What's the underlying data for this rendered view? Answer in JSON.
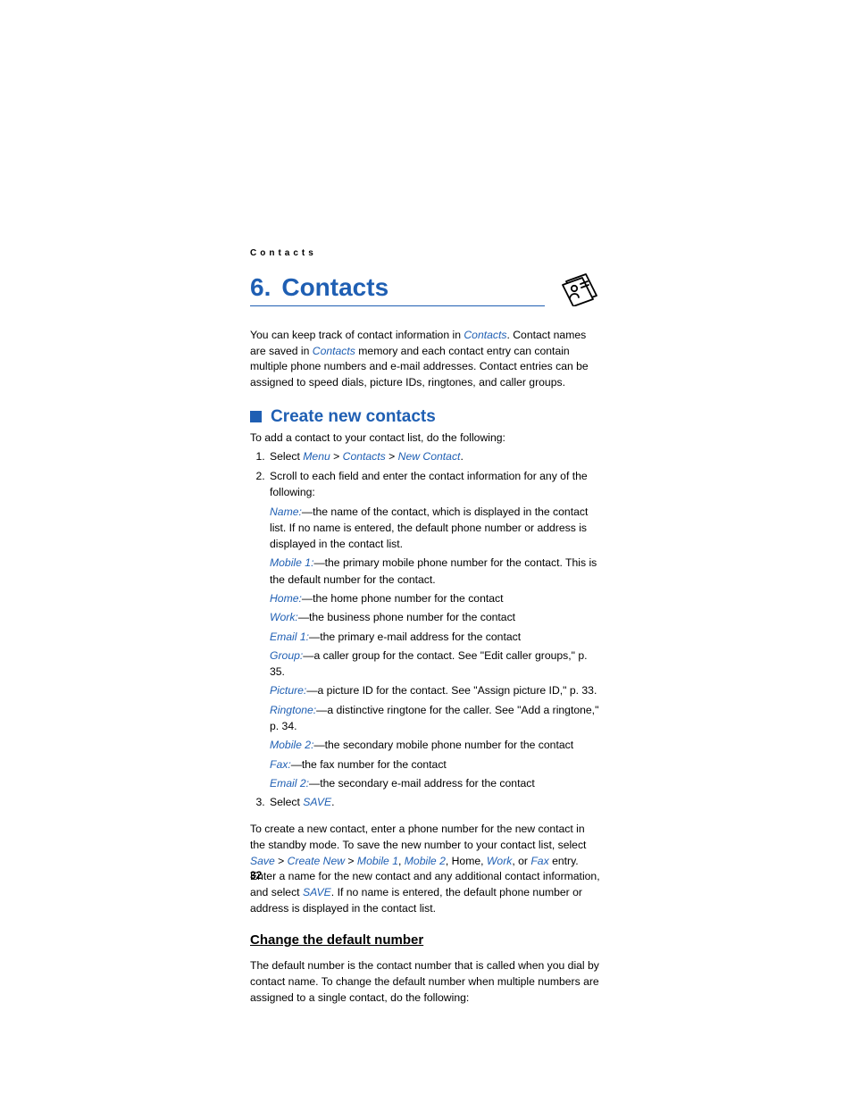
{
  "header": "Contacts",
  "chapter": {
    "num": "6.",
    "title": "Contacts"
  },
  "intro": {
    "t1": "You can keep track of contact information in ",
    "l1": "Contacts",
    "t2": ". Contact names are saved in ",
    "l2": "Contacts",
    "t3": " memory and each contact entry can contain multiple phone numbers and e-mail addresses. Contact entries can be assigned to speed dials, picture IDs, ringtones, and caller groups."
  },
  "sectionCreate": "Create new contacts",
  "createLead": "To add a contact to your contact list, do the following:",
  "step1": {
    "pre": "Select ",
    "menu": "Menu",
    "gt1": " > ",
    "contacts": "Contacts",
    "gt2": " > ",
    "newc": "New Contact",
    "post": "."
  },
  "step2": "Scroll to each field and enter the contact information for any of the following:",
  "fields": {
    "name": {
      "lbl": "Name:",
      "txt": "—the name of the contact, which is displayed in the contact list. If no name is entered, the default phone number or address is displayed in the contact list."
    },
    "mobile1": {
      "lbl": "Mobile 1:",
      "txt": "—the primary mobile phone number for the contact. This is the default number for the contact."
    },
    "home": {
      "lbl": "Home:",
      "txt": "—the home phone number for the contact"
    },
    "work": {
      "lbl": "Work:",
      "txt": "—the business phone number for the contact"
    },
    "email1": {
      "lbl": "Email 1:",
      "txt": "—the primary e-mail address for the contact"
    },
    "group": {
      "lbl": "Group:",
      "txt": "—a caller group for the contact. See \"Edit caller groups,\" p. 35."
    },
    "picture": {
      "lbl": "Picture:",
      "txt": "—a picture ID for the contact. See \"Assign picture ID,\" p. 33."
    },
    "ringtone": {
      "lbl": "Ringtone:",
      "txt": "—a distinctive ringtone for the caller. See \"Add a ringtone,\" p. 34."
    },
    "mobile2": {
      "lbl": "Mobile 2:",
      "txt": "—the secondary mobile phone number for the contact"
    },
    "fax": {
      "lbl": "Fax:",
      "txt": "—the fax number for the contact"
    },
    "email2": {
      "lbl": "Email 2:",
      "txt": "—the secondary e-mail address for the contact"
    }
  },
  "step3": {
    "pre": "Select ",
    "save": "SAVE",
    "post": "."
  },
  "para2": {
    "t1": "To create a new contact, enter a phone number for the new contact in the standby mode. To save the new number to your contact list, select ",
    "save": "Save",
    "gt1": " > ",
    "createnew": "Create New",
    "gt2": " > ",
    "mobile1": "Mobile 1",
    "comma1": ", ",
    "mobile2": "Mobile 2",
    "comma2": ", Home, ",
    "work": "Work",
    "comma3": ", or ",
    "fax": "Fax",
    "t2": " entry. Enter a name for the new contact and any additional contact information, and select ",
    "save2": "SAVE",
    "t3": ". If no name is entered, the default phone number or address is displayed in the contact list."
  },
  "sub": "Change the default number",
  "subPara": "The default number is the contact number that is called when you dial by contact name. To change the default number when multiple numbers are assigned to a single contact, do the following:",
  "pageNum": "32"
}
